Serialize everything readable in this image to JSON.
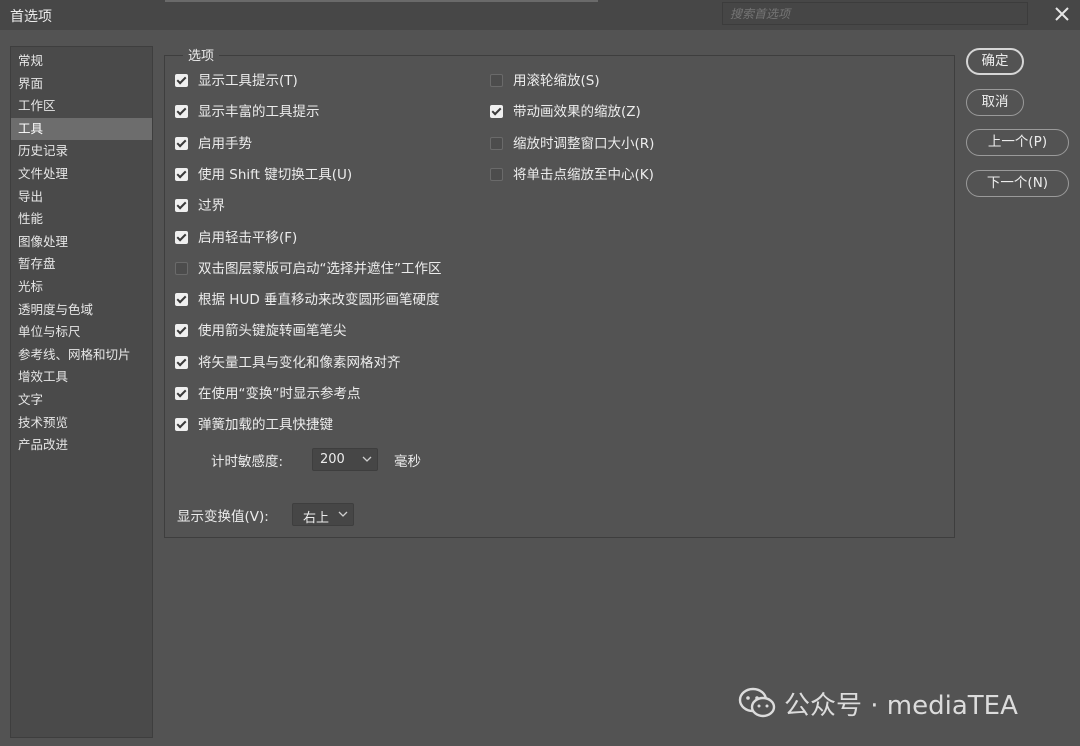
{
  "window": {
    "title": "首选项"
  },
  "search": {
    "placeholder": "搜索首选项"
  },
  "sidebar": {
    "items": [
      {
        "label": "常规"
      },
      {
        "label": "界面"
      },
      {
        "label": "工作区"
      },
      {
        "label": "工具",
        "selected": true
      },
      {
        "label": "历史记录"
      },
      {
        "label": "文件处理"
      },
      {
        "label": "导出"
      },
      {
        "label": "性能"
      },
      {
        "label": "图像处理"
      },
      {
        "label": "暂存盘"
      },
      {
        "label": "光标"
      },
      {
        "label": "透明度与色域"
      },
      {
        "label": "单位与标尺"
      },
      {
        "label": "参考线、网格和切片"
      },
      {
        "label": "增效工具"
      },
      {
        "label": "文字"
      },
      {
        "label": "技术预览"
      },
      {
        "label": "产品改进"
      }
    ]
  },
  "options": {
    "legend": "选项",
    "left": [
      {
        "label": "显示工具提示(T)",
        "checked": true
      },
      {
        "label": "显示丰富的工具提示",
        "checked": true
      },
      {
        "label": "启用手势",
        "checked": true
      },
      {
        "label": "使用 Shift 键切换工具(U)",
        "checked": true
      },
      {
        "label": "过界",
        "checked": true
      },
      {
        "label": "启用轻击平移(F)",
        "checked": true
      },
      {
        "label": "双击图层蒙版可启动“选择并遮住”工作区",
        "checked": false
      },
      {
        "label": "根据 HUD 垂直移动来改变圆形画笔硬度",
        "checked": true
      },
      {
        "label": "使用箭头键旋转画笔笔尖",
        "checked": true
      },
      {
        "label": "将矢量工具与变化和像素网格对齐",
        "checked": true
      },
      {
        "label": "在使用“变换”时显示参考点",
        "checked": true
      },
      {
        "label": "弹簧加载的工具快捷键",
        "checked": true
      }
    ],
    "right": [
      {
        "label": "用滚轮缩放(S)",
        "checked": false
      },
      {
        "label": "带动画效果的缩放(Z)",
        "checked": true
      },
      {
        "label": "缩放时调整窗口大小(R)",
        "checked": false
      },
      {
        "label": "将单击点缩放至中心(K)",
        "checked": false
      }
    ],
    "timer": {
      "label": "计时敏感度:",
      "value": "200",
      "unit": "毫秒"
    },
    "transform": {
      "label": "显示变换值(V):",
      "value": "右上"
    }
  },
  "buttons": {
    "ok": "确定",
    "cancel": "取消",
    "prev": "上一个(P)",
    "next": "下一个(N)"
  },
  "watermark": {
    "text": "公众号 · mediaTEA"
  }
}
